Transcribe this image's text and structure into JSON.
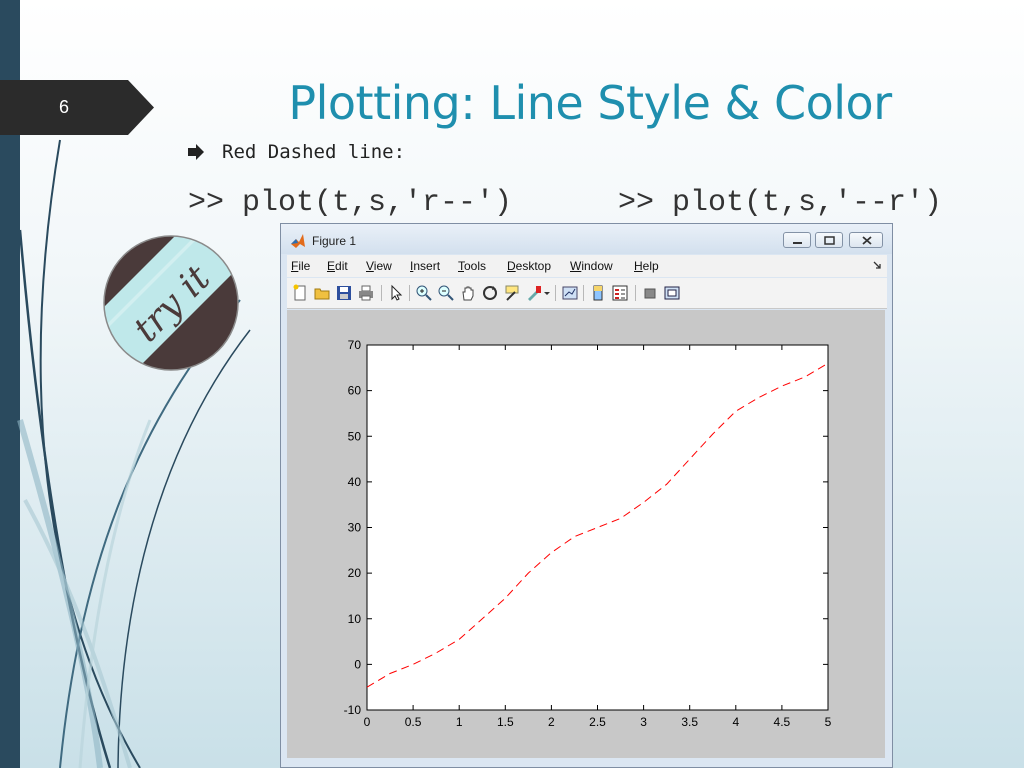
{
  "slide": {
    "number": "6",
    "title": "Plotting: Line Style & Color",
    "bullet": "Red Dashed line:",
    "code_left": ">> plot(t,s,'r--')",
    "code_right": ">> plot(t,s,'--r')",
    "badge_text": "try it"
  },
  "figure_window": {
    "title": "Figure 1",
    "menu": [
      "File",
      "Edit",
      "View",
      "Insert",
      "Tools",
      "Desktop",
      "Window",
      "Help"
    ],
    "toolbar_icons": [
      "new-figure-icon",
      "open-file-icon",
      "save-icon",
      "print-icon",
      "select-pointer-icon",
      "zoom-in-icon",
      "zoom-out-icon",
      "pan-hand-icon",
      "rotate-3d-icon",
      "data-cursor-icon",
      "brush-icon",
      "link-plot-icon",
      "colorbar-icon",
      "legend-icon",
      "hide-plot-tools-icon",
      "show-plot-tools-icon"
    ]
  },
  "colors": {
    "title": "#1f8fae",
    "line": "#ff0000",
    "sidebar": "#2a4a5e",
    "plot_bg": "#c8c8c8"
  },
  "chart_data": {
    "type": "line",
    "line_style": "dashed",
    "line_color": "#ff0000",
    "x": [
      0,
      0.25,
      0.5,
      0.75,
      1,
      1.25,
      1.5,
      1.75,
      2,
      2.25,
      2.5,
      2.75,
      3,
      3.25,
      3.5,
      3.75,
      4,
      4.25,
      4.5,
      4.75,
      5
    ],
    "y": [
      -5,
      -2,
      0,
      2.5,
      5.5,
      10,
      14.5,
      20,
      24.5,
      28,
      30,
      32,
      35.5,
      39.5,
      45,
      50.5,
      55.5,
      58.5,
      61,
      63,
      66
    ],
    "xlim": [
      0,
      5
    ],
    "ylim": [
      -10,
      70
    ],
    "xticks": [
      "0",
      "0.5",
      "1",
      "1.5",
      "2",
      "2.5",
      "3",
      "3.5",
      "4",
      "4.5",
      "5"
    ],
    "yticks": [
      "-10",
      "0",
      "10",
      "20",
      "30",
      "40",
      "50",
      "60",
      "70"
    ],
    "grid": false,
    "title": "",
    "xlabel": "",
    "ylabel": ""
  }
}
